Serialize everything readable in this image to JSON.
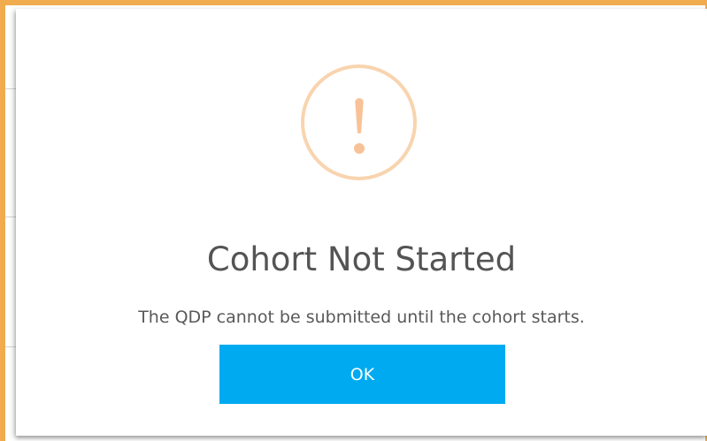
{
  "dialog": {
    "title": "Cohort Not Started",
    "message": "The QDP cannot be submitted until the cohort starts.",
    "ok_label": "OK",
    "icon": "exclamation-icon"
  },
  "colors": {
    "accent_border": "#f0ac4e",
    "warning_ring": "#f8d4af",
    "warning_mark": "#f8c298",
    "button": "#00aaf0"
  }
}
